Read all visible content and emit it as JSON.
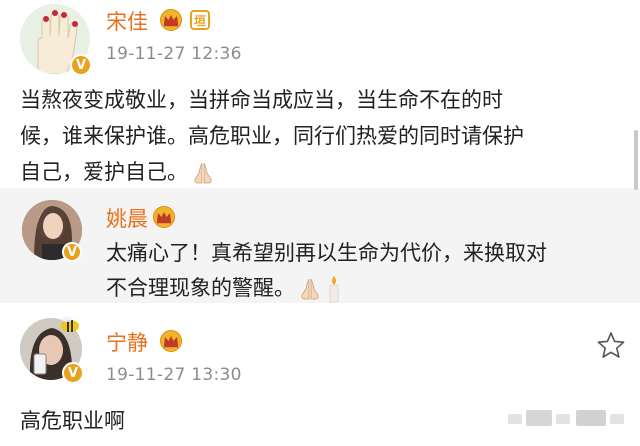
{
  "comments": [
    {
      "name": "宋佳",
      "time": "19-11-27 12:36",
      "text_lines": [
        "当熬夜变成敬业，当拼命当成应当，当生命不在的时",
        "候，谁来保护谁。高危职业，同行们热爱的同时请保护",
        "自己，爱护自己。"
      ],
      "tag_badge": "垣",
      "verified": "V"
    },
    {
      "name": "姚晨",
      "text_lines": [
        "太痛心了！真希望别再以生命为代价，来换取对",
        "不合理现象的警醒。"
      ],
      "verified": "V"
    },
    {
      "name": "宁静",
      "time": "19-11-27 13:30",
      "text_lines": [
        "高危职业啊"
      ],
      "verified": "V"
    }
  ],
  "icons": {
    "crown": "crown-icon",
    "pray": "praying-hands-icon",
    "candle": "candle-icon",
    "star": "star-icon"
  },
  "colors": {
    "name": "#e8711e",
    "verified_badge": "#e8a21c",
    "reply_background": "#f4f4f4"
  }
}
